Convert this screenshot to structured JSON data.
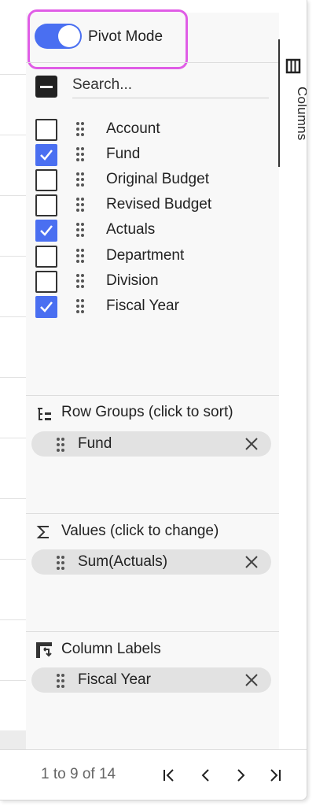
{
  "pivot_mode": {
    "label": "Pivot Mode",
    "enabled": true,
    "toggle_color": "#4a6ff1",
    "highlight_color": "#e05de6"
  },
  "column_search": {
    "placeholder": "Search..."
  },
  "columns": [
    {
      "label": "Account",
      "checked": false
    },
    {
      "label": "Fund",
      "checked": true
    },
    {
      "label": "Original Budget",
      "checked": false
    },
    {
      "label": "Revised Budget",
      "checked": false
    },
    {
      "label": "Actuals",
      "checked": true
    },
    {
      "label": "Department",
      "checked": false
    },
    {
      "label": "Division",
      "checked": false
    },
    {
      "label": "Fiscal Year",
      "checked": true
    }
  ],
  "row_groups": {
    "title": "Row Groups (click to sort)",
    "icon": "row-group-icon",
    "items": [
      "Fund"
    ]
  },
  "values": {
    "title": "Values (click to change)",
    "icon": "sigma-icon",
    "items": [
      "Sum(Actuals)"
    ]
  },
  "column_labels": {
    "title": "Column Labels",
    "icon": "pivot-icon",
    "items": [
      "Fiscal Year"
    ]
  },
  "side_tab": {
    "label": "Columns",
    "icon": "columns-icon"
  },
  "pagination": {
    "summary": "1 to 9 of 14"
  }
}
